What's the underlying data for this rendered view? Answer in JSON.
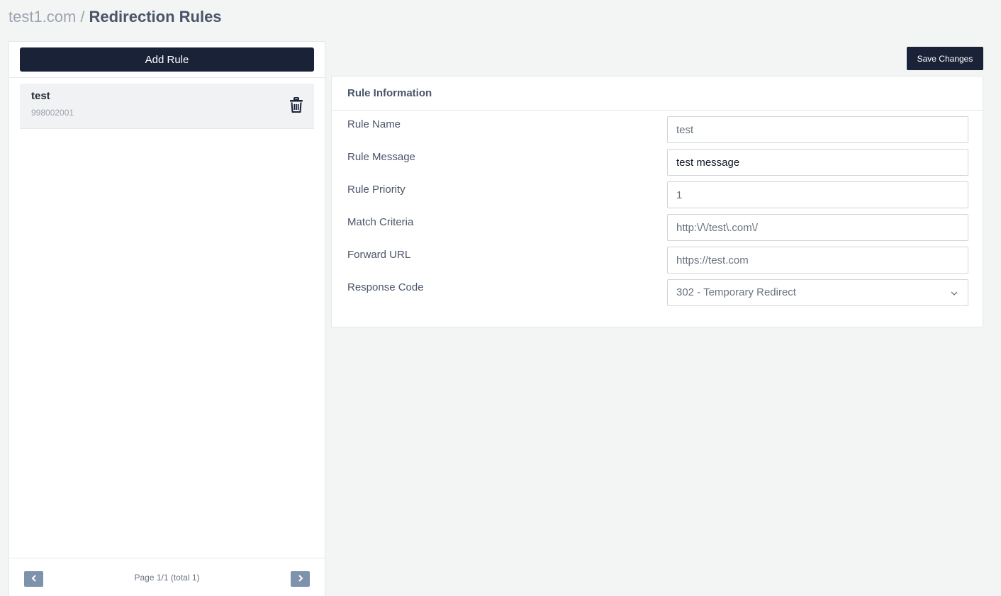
{
  "breadcrumb": {
    "site": "test1.com",
    "separator": "/",
    "current": "Redirection Rules"
  },
  "sidebar": {
    "add_button_label": "Add Rule",
    "rules": [
      {
        "name": "test",
        "id": "998002001"
      }
    ],
    "pager": {
      "text": "Page 1/1 (total 1)"
    }
  },
  "toolbar": {
    "save_label": "Save Changes"
  },
  "rule_card": {
    "title": "Rule Information",
    "fields": {
      "rule_name": {
        "label": "Rule Name",
        "value": "test"
      },
      "rule_message": {
        "label": "Rule Message",
        "value": "test message"
      },
      "rule_priority": {
        "label": "Rule Priority",
        "value": "1"
      },
      "match_criteria": {
        "label": "Match Criteria",
        "value": "http:\\/\\/test\\.com\\/"
      },
      "forward_url": {
        "label": "Forward URL",
        "value": "https://test.com"
      },
      "response_code": {
        "label": "Response Code",
        "value": "302 - Temporary Redirect"
      }
    }
  },
  "icons": {
    "delete": "trash-icon",
    "prev": "chevron-left-icon",
    "next": "chevron-right-icon",
    "select": "chevron-down-icon"
  },
  "colors": {
    "primary_button": "#1a2238",
    "pager_button": "#7f92ac",
    "background": "#f3f4f4"
  }
}
